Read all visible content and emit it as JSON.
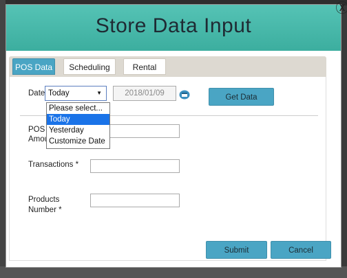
{
  "dialog": {
    "title": "Store Data Input",
    "close_icon": "Ⓧ"
  },
  "tabs": [
    {
      "label": "POS Data",
      "active": true
    },
    {
      "label": "Scheduling",
      "active": false
    },
    {
      "label": "Rental",
      "active": false
    }
  ],
  "form": {
    "date_label": "Date",
    "date_select_value": "Today",
    "date_value": "2018/01/09",
    "get_data_label": "Get Data",
    "pos_total_label_line1": "POS T",
    "pos_total_label_line2": "Amou",
    "transactions_label": "Transactions *",
    "products_label_line1": "Products",
    "products_label_line2": "Number *",
    "submit_label": "Submit",
    "cancel_label": "Cancel"
  },
  "dropdown": {
    "options": [
      "Please select...",
      "Today",
      "Yesterday",
      "Customize Date"
    ],
    "highlighted": "Today"
  },
  "colors": {
    "header": "#48b8aa",
    "accent_button": "#4aa5c4",
    "dropdown_highlight": "#1a73e8"
  },
  "icons": {
    "calendar": "calendar-icon",
    "close": "close-icon",
    "dropdown_arrow": "chevron-down-icon"
  }
}
